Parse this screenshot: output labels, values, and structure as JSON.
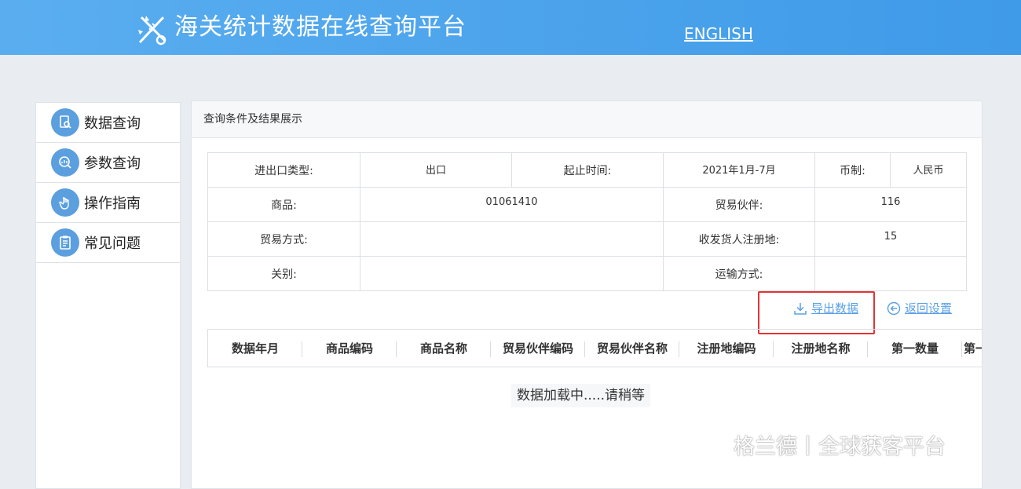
{
  "header": {
    "title": "海关统计数据在线查询平台",
    "lang_link": "ENGLISH"
  },
  "sidebar": {
    "items": [
      {
        "label": "数据查询",
        "icon": "search-doc-icon"
      },
      {
        "label": "参数查询",
        "icon": "magnify-chart-icon"
      },
      {
        "label": "操作指南",
        "icon": "hand-pointer-icon"
      },
      {
        "label": "常见问题",
        "icon": "clipboard-icon"
      }
    ]
  },
  "panel": {
    "title": "查询条件及结果展示",
    "conditions": {
      "trade_type_label": "进出口类型:",
      "trade_type_value": "出口",
      "period_label": "起止时间:",
      "period_value": "2021年1月-7月",
      "currency_label": "币制:",
      "currency_value": "人民币",
      "commodity_label": "商品:",
      "commodity_value": "01061410",
      "partner_label": "贸易伙伴:",
      "partner_value": "116",
      "trade_mode_label": "贸易方式:",
      "trade_mode_value": "",
      "registration_label": "收发货人注册地:",
      "registration_value": "15",
      "customs_label": "关别:",
      "customs_value": "",
      "transport_label": "运输方式:",
      "transport_value": ""
    },
    "actions": {
      "export_label": "导出数据",
      "back_label": "返回设置"
    },
    "result_columns": [
      "数据年月",
      "商品编码",
      "商品名称",
      "贸易伙伴编码",
      "贸易伙伴名称",
      "注册地编码",
      "注册地名称",
      "第一数量",
      "第一计量"
    ],
    "loading_text": "数据加载中.....请稍等"
  },
  "watermark": {
    "text": "格兰德丨全球获客平台"
  },
  "colors": {
    "header": "#4aa3ee",
    "link": "#5aa0e6",
    "highlight": "#e53333",
    "icon_circle": "#5b9fdf"
  }
}
